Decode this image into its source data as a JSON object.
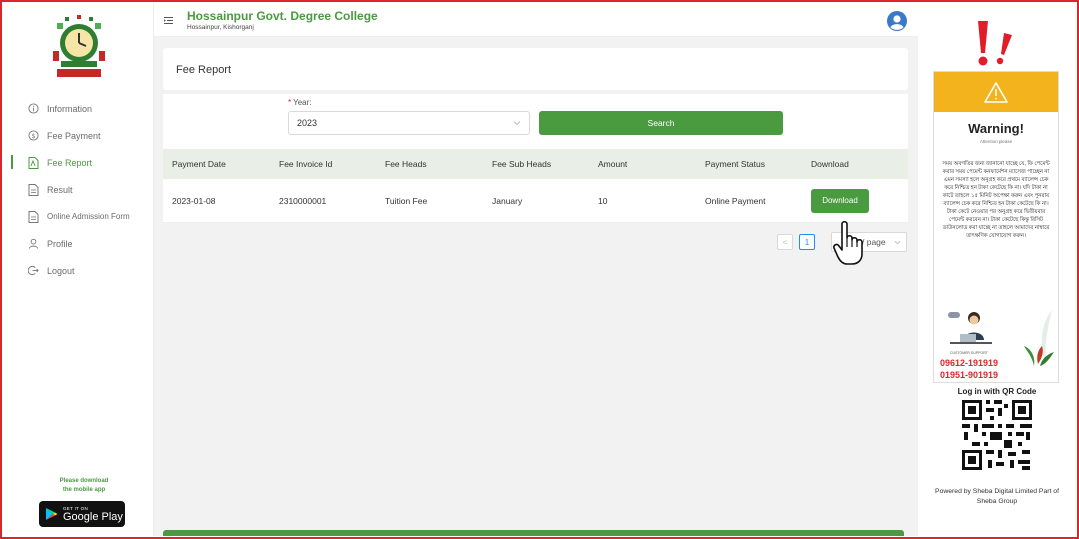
{
  "colors": {
    "brand_green": "#4a9a3f",
    "frame_red": "#d9262c",
    "warning_yellow": "#f2b31c",
    "link_blue": "#1890ff"
  },
  "sidebar": {
    "items": [
      {
        "label": "Information",
        "icon": "info-icon",
        "active": false
      },
      {
        "label": "Fee Payment",
        "icon": "dollar-circle-icon",
        "active": false
      },
      {
        "label": "Fee Report",
        "icon": "file-pdf-icon",
        "active": true
      },
      {
        "label": "Result",
        "icon": "file-text-icon",
        "active": false
      },
      {
        "label": "Online Admission Form",
        "icon": "file-text-icon",
        "active": false
      },
      {
        "label": "Profile",
        "icon": "user-icon",
        "active": false
      },
      {
        "label": "Logout",
        "icon": "logout-icon",
        "active": false
      }
    ],
    "app_promo_line1": "Please download",
    "app_promo_line2": "the mobile app",
    "store_small": "GET IT ON",
    "store_big": "Google Play"
  },
  "header": {
    "college_name": "Hossainpur Govt. Degree College",
    "college_location": "Hossainpur, Kishorganj"
  },
  "page": {
    "title": "Fee Report"
  },
  "search": {
    "year_label": "Year:",
    "year_required_mark": "*",
    "year_value": "2023",
    "button_label": "Search"
  },
  "table": {
    "headers": [
      "Payment Date",
      "Fee Invoice Id",
      "Fee Heads",
      "Fee Sub Heads",
      "Amount",
      "Payment Status",
      "Download"
    ],
    "rows": [
      {
        "date": "2023-01-08",
        "invoice": "2310000001",
        "head": "Tuition Fee",
        "sub_head": "January",
        "amount": "10",
        "status": "Online Payment",
        "download_label": "Download"
      }
    ]
  },
  "pagination": {
    "prev": "<",
    "current_page": "1",
    "page_size_label": "/ page"
  },
  "right_panel": {
    "warning_title": "Warning!",
    "warning_subtitle": "Attention please",
    "warning_body": "সময় অবগতির জন্য জানানো যাচ্ছে যে, ফি পেমেন্ট করার সময় পেমেন্ট কনফার্মেশন ম্যাসেজ পাচ্ছেন না এমন সমস্যা হলে অনুগ্রহ করে প্রথমে ব্যালেন্স চেক করে নিশ্চিত হন টাকা কেটেছে কি না। যদি টাকা না কাটে তাহলে ১৫ মিনিট অপেক্ষা করুন এবং পুনরায় ব্যালেন্স চেক করে নিশ্চিত হন টাকা কেটেছে কি না। টাকা কেটে নেওয়ার পর অনুগ্রহ করে দ্বিতীয়বার পেমেন্ট করবেন না। টাকা কেটেছে কিন্তু রিসিট ডাউনলোড করা যাচ্ছে না তাহলে আমাদের নাম্বারে তাৎক্ষণিক যোগাযোগ করুন।",
    "support_caption": "CUSTOMER SUPPORT",
    "phone_1": "09612-191919",
    "phone_2": "01951-901919",
    "qr_title": "Log in with QR Code",
    "powered_by": "Powered by Sheba Digital Limited Part of Sheba Group"
  }
}
